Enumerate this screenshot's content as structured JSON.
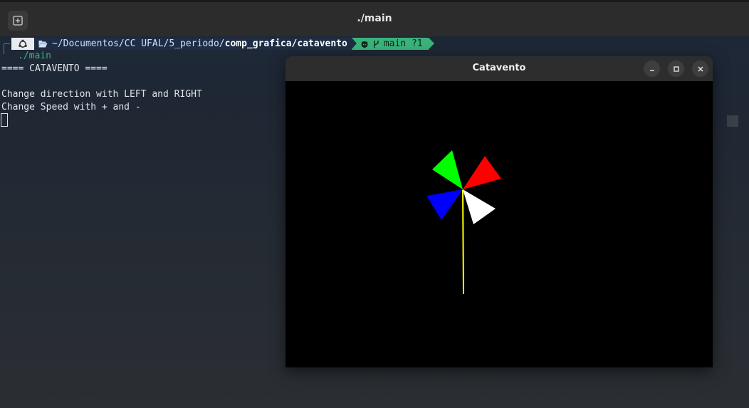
{
  "terminal": {
    "title": "./main",
    "prompt": {
      "path_prefix": "~/Documentos/CC UFAL/5_periodo/",
      "path_bold": "comp_grafica/catavento",
      "git_branch": "main ?1"
    },
    "command": "./main",
    "output": [
      "==== CATAVENTO ====",
      "",
      "Change direction with LEFT and RIGHT",
      "Change Speed with + and -"
    ]
  },
  "gl_window": {
    "title": "Catavento",
    "buttons": [
      "minimize",
      "maximize",
      "close"
    ]
  },
  "pinwheel": {
    "blades": [
      {
        "name": "green",
        "color": "#00ff00"
      },
      {
        "name": "red",
        "color": "#ff0000"
      },
      {
        "name": "blue",
        "color": "#0000ff"
      },
      {
        "name": "white",
        "color": "#ffffff"
      }
    ],
    "stick_color": "#ffff00"
  }
}
